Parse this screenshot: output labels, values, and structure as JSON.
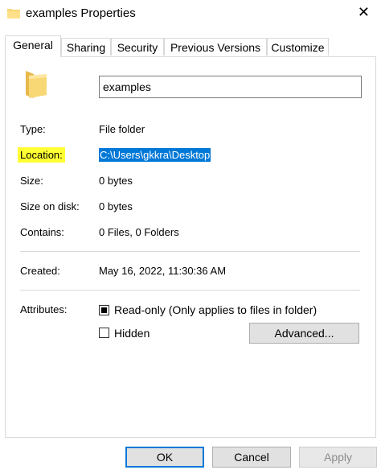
{
  "window": {
    "title": "examples Properties",
    "close_glyph": "✕"
  },
  "tabs": [
    {
      "label": "General",
      "active": true
    },
    {
      "label": "Sharing"
    },
    {
      "label": "Security"
    },
    {
      "label": "Previous Versions"
    },
    {
      "label": "Customize"
    }
  ],
  "folder_name": "examples",
  "properties": {
    "type": {
      "label": "Type:",
      "value": "File folder"
    },
    "location": {
      "label": "Location:",
      "value": "C:\\Users\\gkkra\\Desktop"
    },
    "size": {
      "label": "Size:",
      "value": "0 bytes"
    },
    "size_on_disk": {
      "label": "Size on disk:",
      "value": "0 bytes"
    },
    "contains": {
      "label": "Contains:",
      "value": "0 Files, 0 Folders"
    },
    "created": {
      "label": "Created:",
      "value": "May 16, 2022, 11:30:36 AM"
    }
  },
  "attributes": {
    "label": "Attributes:",
    "readonly": {
      "label": "Read-only (Only applies to files in folder)",
      "state": "indeterminate"
    },
    "hidden": {
      "label": "Hidden",
      "checked": false
    },
    "advanced_label": "Advanced..."
  },
  "buttons": {
    "ok": "OK",
    "cancel": "Cancel",
    "apply": "Apply"
  },
  "colors": {
    "highlight": "#ffff33",
    "selection": "#0078d7",
    "folder": "#f8d775"
  }
}
